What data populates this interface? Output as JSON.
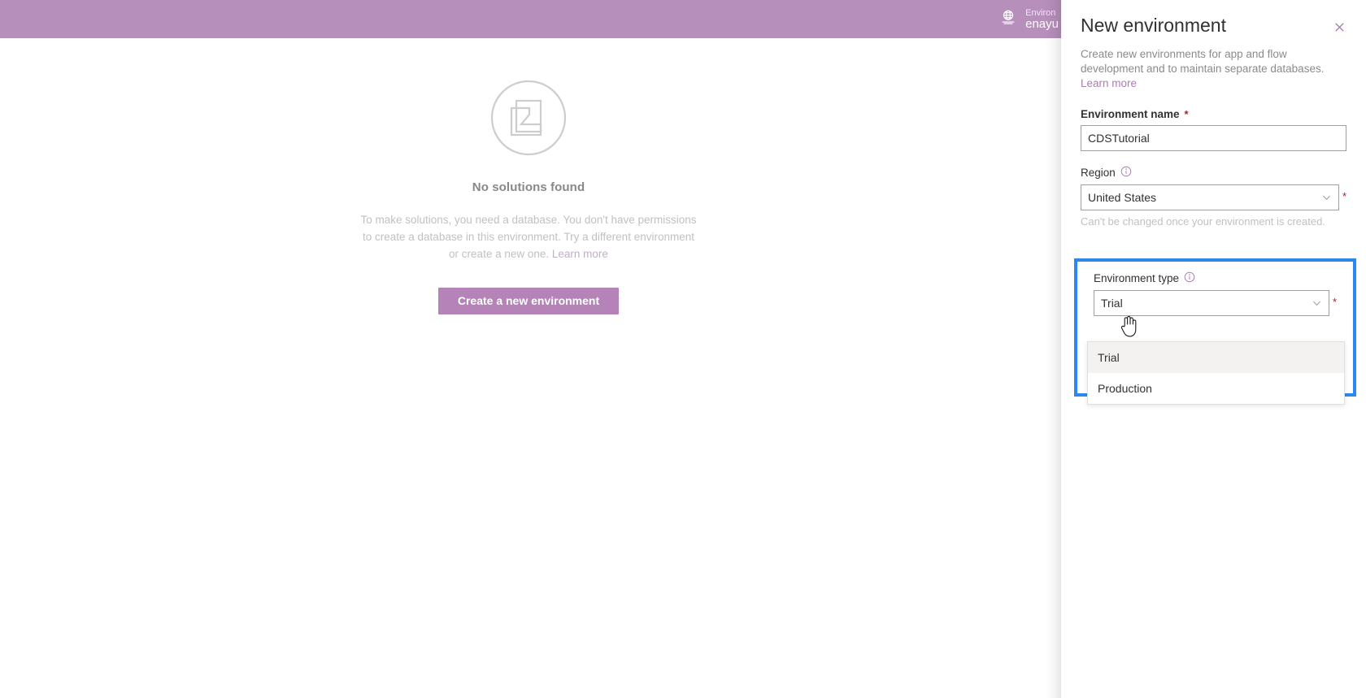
{
  "topbar": {
    "icon": "globe-icon",
    "env_caption": "Environ",
    "env_value": "enayu"
  },
  "main": {
    "empty_state": {
      "illustration": "document-stack-icon",
      "title": "No solutions found",
      "description": "To make solutions, you need a database. You don't have permissions to create a database in this environment. Try a different environment or create a new one.",
      "learn_more": "Learn more",
      "button_label": "Create a new environment"
    }
  },
  "panel": {
    "title": "New environment",
    "close_icon": "close-icon",
    "description": "Create new environments for app and flow development and to maintain separate databases.",
    "learn_more": "Learn more",
    "fields": {
      "environment_name": {
        "label": "Environment name",
        "required_marker": "*",
        "value": "CDSTutorial",
        "placeholder": ""
      },
      "region": {
        "label": "Region",
        "info_icon": "info-icon",
        "required_marker": "*",
        "value": "United States",
        "chevron": "chevron-down-icon",
        "help_text": "Can't be changed once your environment is created."
      },
      "environment_type": {
        "label": "Environment type",
        "info_icon": "info-icon",
        "required_marker": "*",
        "value": "Trial",
        "chevron": "chevron-down-icon",
        "options": [
          {
            "label": "Trial",
            "selected": true
          },
          {
            "label": "Production",
            "selected": false
          }
        ]
      }
    }
  },
  "colors": {
    "brand_purple": "#b68fbb",
    "button_purple": "#b583b7",
    "highlight_blue": "#2b88f0",
    "required_red": "#a4262c",
    "link_purple": "#a97fae"
  }
}
